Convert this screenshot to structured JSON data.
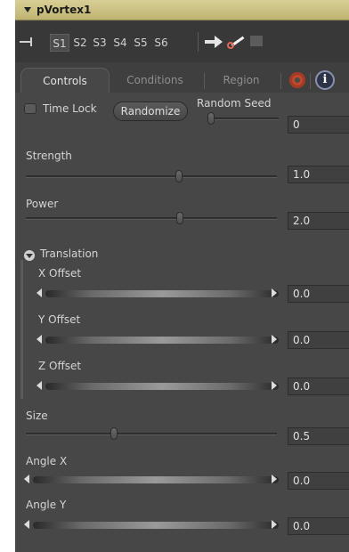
{
  "node": {
    "title": "pVortex1"
  },
  "toolbar": {
    "slots": [
      "S1",
      "S2",
      "S3",
      "S4",
      "S5",
      "S6"
    ],
    "active_slot": "S1"
  },
  "tabs": [
    {
      "label": "Controls",
      "active": true
    },
    {
      "label": "Conditions",
      "active": false
    },
    {
      "label": "Region",
      "active": false
    }
  ],
  "controls": {
    "time_lock": {
      "label": "Time Lock",
      "checked": false
    },
    "randomize_label": "Randomize",
    "random_seed": {
      "label": "Random Seed",
      "value": "0"
    },
    "strength": {
      "label": "Strength",
      "value": "1.0"
    },
    "power": {
      "label": "Power",
      "value": "2.0"
    },
    "translation": {
      "label": "Translation",
      "expanded": true,
      "x_offset": {
        "label": "X Offset",
        "value": "0.0"
      },
      "y_offset": {
        "label": "Y Offset",
        "value": "0.0"
      },
      "z_offset": {
        "label": "Z Offset",
        "value": "0.0"
      }
    },
    "size": {
      "label": "Size",
      "value": "0.5"
    },
    "angle_x": {
      "label": "Angle X",
      "value": "0.0"
    },
    "angle_y": {
      "label": "Angle Y",
      "value": "0.0"
    }
  },
  "colors": {
    "titlebar": "#cfc486",
    "panel": "#474747",
    "gear": "#c0482c",
    "key_ring": "#e06a55"
  },
  "icons": [
    "pin-icon",
    "arrow-right-icon",
    "key-icon",
    "gear-icon",
    "info-icon",
    "disclosure-triangle-icon"
  ]
}
